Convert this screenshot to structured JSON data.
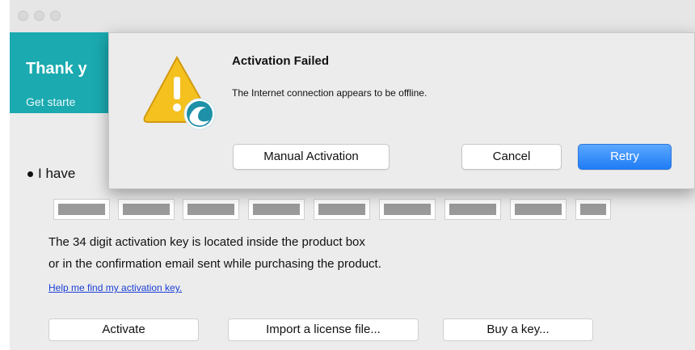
{
  "window": {
    "banner": {
      "title": "Thank y",
      "subtitle": "Get starte",
      "chevron": "‹",
      "color": "#1aaab0"
    }
  },
  "activation": {
    "radio_label": "I have",
    "key_field_count": 9,
    "info_line1": "The 34 digit activation key is located inside the product box",
    "info_line2": "or in the confirmation email sent while purchasing the product.",
    "help_link": "Help me find my activation key.",
    "buttons": {
      "activate": "Activate",
      "import_license": "Import a license file...",
      "buy_key": "Buy a key..."
    }
  },
  "dialog": {
    "icon": "warning-app-icon",
    "title": "Activation Failed",
    "message": "The Internet connection appears to be offline.",
    "buttons": {
      "manual_activation": "Manual Activation",
      "cancel": "Cancel",
      "retry": "Retry"
    },
    "primary_color": "#1f7cf5"
  }
}
